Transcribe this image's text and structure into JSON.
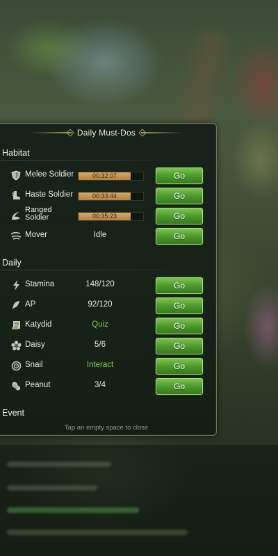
{
  "title": "Daily Must-Dos",
  "sections": {
    "habitat": "Habitat",
    "daily": "Daily",
    "event": "Event"
  },
  "habitat_rows": [
    {
      "icon": "shield-icon",
      "label": "Melee Soldier",
      "timer": "00:32:07",
      "progress": 0.81,
      "go": "Go"
    },
    {
      "icon": "boot-icon",
      "label": "Haste Soldier",
      "timer": "00:33:44",
      "progress": 0.81,
      "go": "Go"
    },
    {
      "icon": "ranged-icon",
      "label": "Ranged Soldier",
      "timer": "00:35:23",
      "progress": 0.81,
      "go": "Go"
    },
    {
      "icon": "mover-icon",
      "label": "Mover",
      "status": "Idle",
      "go": "Go"
    }
  ],
  "daily_rows": [
    {
      "icon": "lightning-icon",
      "label": "Stamina",
      "value": "148/120",
      "value_color": "white",
      "go": "Go"
    },
    {
      "icon": "ap-icon",
      "label": "AP",
      "value": "92/120",
      "value_color": "white",
      "go": "Go"
    },
    {
      "icon": "scroll-icon",
      "label": "Katydid",
      "value": "Quiz",
      "value_color": "green",
      "go": "Go"
    },
    {
      "icon": "flower-icon",
      "label": "Daisy",
      "value": "5/6",
      "value_color": "white",
      "go": "Go"
    },
    {
      "icon": "snail-icon",
      "label": "Snail",
      "value": "Interact",
      "value_color": "green",
      "go": "Go"
    },
    {
      "icon": "peanut-icon",
      "label": "Peanut",
      "value": "3/4",
      "value_color": "white",
      "go": "Go"
    }
  ],
  "hint": "Tap an empty space to close",
  "colors": {
    "accent_green": "#7fd04a",
    "button_green": "#4c9a2c",
    "progress_gold": "#c99552"
  }
}
